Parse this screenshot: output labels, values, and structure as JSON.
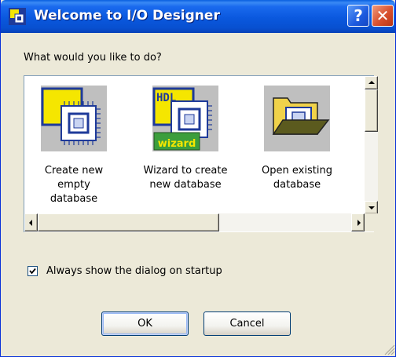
{
  "window": {
    "title": "Welcome to I/O Designer",
    "help_glyph": "?",
    "close_glyph": "✕",
    "app_icon": "io-designer-icon"
  },
  "dialog": {
    "prompt": "What would you like to do?",
    "options": [
      {
        "label_line1": "Create new empty",
        "label_line2": "database",
        "icon": "chip-icon"
      },
      {
        "label_line1": "Wizard to create",
        "label_line2": "new database",
        "icon": "hdl-wizard-icon",
        "icon_badge_top": "HDL",
        "icon_badge_bottom": "wizard"
      },
      {
        "label_line1": "Open existing",
        "label_line2": "database",
        "icon": "open-folder-icon"
      }
    ],
    "startup_checkbox": {
      "label": "Always show the dialog on startup",
      "checked": true
    },
    "ok_label": "OK",
    "cancel_label": "Cancel"
  },
  "colors": {
    "titlebar": "#0A58DE",
    "window_bg": "#ECE9D8",
    "chip_yellow": "#F5E600",
    "chip_blue": "#1E3A9A",
    "wizard_green": "#3C9E3C"
  }
}
